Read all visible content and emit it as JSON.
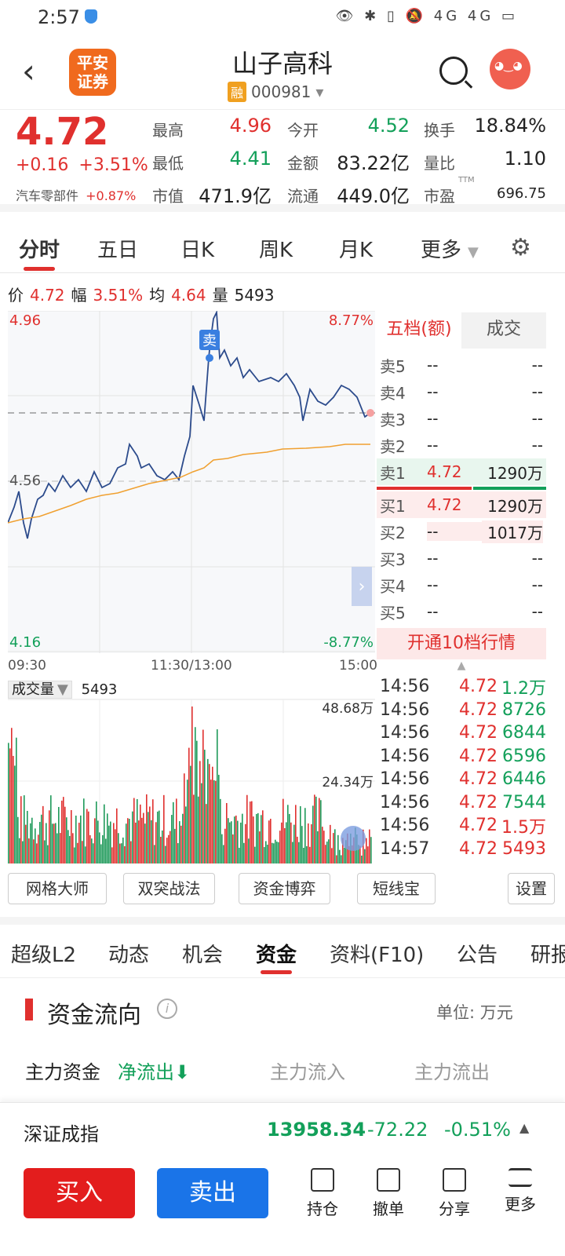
{
  "status": {
    "time": "2:57",
    "icons_text": "👁 ✱ ▯ 🔕 4G 4G ▭"
  },
  "header": {
    "title": "山子高科",
    "badge": "融",
    "code": "000981",
    "logo_text_1": "平安",
    "logo_text_2": "证券"
  },
  "quote": {
    "price": "4.72",
    "change": "+0.16",
    "change_pct": "+3.51%",
    "sector": "汽车零部件",
    "sector_chg": "+0.87%",
    "high_l": "最高",
    "high": "4.96",
    "open_l": "今开",
    "open": "4.52",
    "turn_l": "换手",
    "turn": "18.84%",
    "low_l": "最低",
    "low": "4.41",
    "amt_l": "金额",
    "amt": "83.22亿",
    "vr_l": "量比",
    "vr": "1.10",
    "mcap_l": "市值",
    "mcap": "471.9亿",
    "float_l": "流通",
    "float": "449.0亿",
    "pe_l": "市盈",
    "pe_sup": "TTM",
    "pe": "696.75"
  },
  "ktabs": [
    "分时",
    "五日",
    "日K",
    "周K",
    "月K",
    "更多"
  ],
  "priceline": {
    "jia": "价",
    "p": "4.72",
    "fu": "幅",
    "pct": "3.51%",
    "jun": "均",
    "avg": "4.64",
    "liang": "量",
    "vol": "5493"
  },
  "chart": {
    "top": "4.96",
    "mid": "4.56",
    "bot": "4.16",
    "top_pct": "8.77%",
    "bot_pct": "-8.77%",
    "t0": "09:30",
    "t1": "11:30/13:00",
    "t2": "15:00",
    "marker": "卖"
  },
  "volume": {
    "label": "成交量",
    "value": "5493",
    "max": "48.68万",
    "half": "24.34万"
  },
  "book": {
    "tab1": "五档(额)",
    "tab2": "成交",
    "sells": [
      {
        "n": "卖5",
        "p": "--",
        "q": "--"
      },
      {
        "n": "卖4",
        "p": "--",
        "q": "--"
      },
      {
        "n": "卖3",
        "p": "--",
        "q": "--"
      },
      {
        "n": "卖2",
        "p": "--",
        "q": "--"
      },
      {
        "n": "卖1",
        "p": "4.72",
        "q": "1290万"
      }
    ],
    "buys": [
      {
        "n": "买1",
        "p": "4.72",
        "q": "1290万"
      },
      {
        "n": "买2",
        "p": "--",
        "q": "1017万"
      },
      {
        "n": "买3",
        "p": "--",
        "q": "--"
      },
      {
        "n": "买4",
        "p": "--",
        "q": "--"
      },
      {
        "n": "买5",
        "p": "--",
        "q": "--"
      }
    ],
    "open10": "开通10档行情"
  },
  "ticks": [
    {
      "t": "14:56",
      "p": "4.72",
      "v": "1.2万",
      "c": "green"
    },
    {
      "t": "14:56",
      "p": "4.72",
      "v": "8726",
      "c": "green"
    },
    {
      "t": "14:56",
      "p": "4.72",
      "v": "6844",
      "c": "green"
    },
    {
      "t": "14:56",
      "p": "4.72",
      "v": "6596",
      "c": "green"
    },
    {
      "t": "14:56",
      "p": "4.72",
      "v": "6446",
      "c": "green"
    },
    {
      "t": "14:56",
      "p": "4.72",
      "v": "7544",
      "c": "green"
    },
    {
      "t": "14:56",
      "p": "4.72",
      "v": "1.5万",
      "c": "red"
    },
    {
      "t": "14:57",
      "p": "4.72",
      "v": "5493",
      "c": "red"
    }
  ],
  "tools": [
    "网格大师",
    "双突战法",
    "资金博弈",
    "短线宝",
    "设置"
  ],
  "sections": [
    "超级L2",
    "动态",
    "机会",
    "资金",
    "资料(F10)",
    "公告",
    "研报"
  ],
  "flow": {
    "title": "资金流向",
    "unit": "单位: 万元",
    "main": "主力资金",
    "net": "净流出",
    "in": "主力流入",
    "out": "主力流出"
  },
  "index": {
    "name": "深证成指",
    "value": "13958.34",
    "chg": "-72.22",
    "pct": "-0.51%"
  },
  "bottom": {
    "buy": "买入",
    "sell": "卖出",
    "hold": "持仓",
    "cancel": "撤单",
    "share": "分享",
    "more": "更多"
  }
}
